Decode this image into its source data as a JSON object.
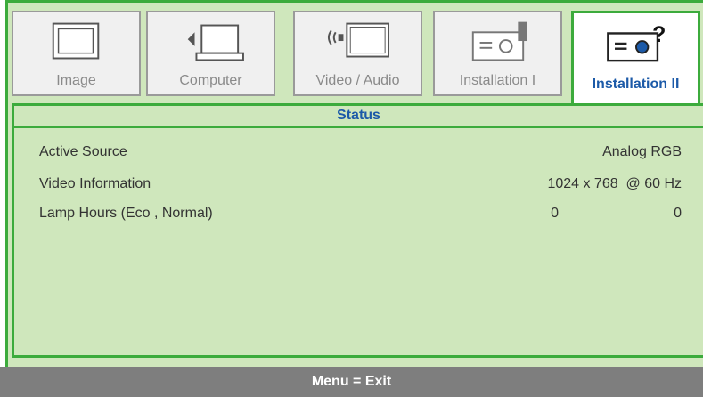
{
  "tabs": [
    {
      "label": "Image",
      "icon": "monitor-icon"
    },
    {
      "label": "Computer",
      "icon": "computer-icon"
    },
    {
      "label": "Video / Audio",
      "icon": "video-audio-icon"
    },
    {
      "label": "Installation I",
      "icon": "projector-icon"
    },
    {
      "label": "Installation II",
      "icon": "projector-question-icon"
    }
  ],
  "active_tab": "Installation II",
  "section_title": "Status",
  "rows": [
    {
      "label": "Active Source",
      "value": "Analog RGB"
    },
    {
      "label": "Video Information",
      "value": "1024 x 768  @ 60 Hz"
    },
    {
      "label": "Lamp Hours (Eco , Normal)",
      "value_eco": "0",
      "value_normal": "0"
    }
  ],
  "footer": "Menu = Exit",
  "colors": {
    "accent": "#3cab3c",
    "panel": "#cfe7bc",
    "title": "#1c5aa8",
    "footer": "#7e7e7e"
  }
}
